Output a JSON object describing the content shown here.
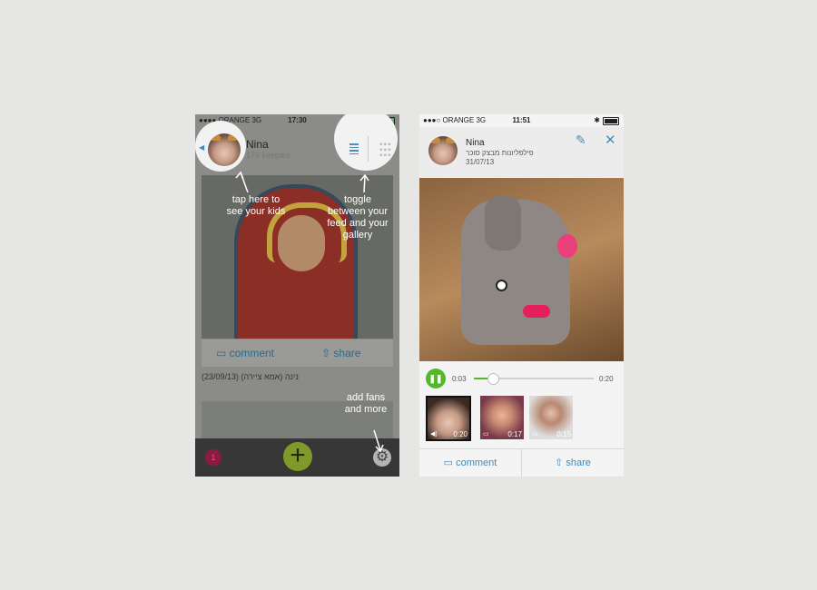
{
  "left": {
    "status": {
      "carrier": "●●●● ORANGE  3G",
      "time": "17:30"
    },
    "header": {
      "name": "Nina",
      "subtitle": "179 keepies"
    },
    "post": {
      "comment": "comment",
      "share": "share",
      "caption": "(23/09/13) ‏נינה (אמא ציירה)"
    },
    "bottom": {
      "badge": "1"
    },
    "tips": {
      "avatar": "tap here to\nsee your kids",
      "toggle": "toggle\nbetween your\nfeed and your\ngallery",
      "settings": "add fans\nand more"
    }
  },
  "right": {
    "status": {
      "carrier": "●●●○ ORANGE  3G",
      "time": "11:51"
    },
    "header": {
      "name": "Nina",
      "subtitle": "פילפליונות מבצק סוכר",
      "date": "31/07/13"
    },
    "player": {
      "current": "0:03",
      "total": "0:20",
      "progress": 0.15
    },
    "thumbs": [
      {
        "duration": "0:20"
      },
      {
        "duration": "0:17"
      },
      {
        "duration": "0:15"
      }
    ],
    "actions": {
      "comment": "comment",
      "share": "share"
    }
  },
  "colors": {
    "accent": "#4d8fb3",
    "green": "#55b82a",
    "plus": "#7f9a29"
  },
  "icons": [
    "edit-icon",
    "close-icon",
    "pause-icon",
    "video-icon",
    "share-icon",
    "gear-icon",
    "plus-icon",
    "list-icon",
    "grid-icon"
  ]
}
